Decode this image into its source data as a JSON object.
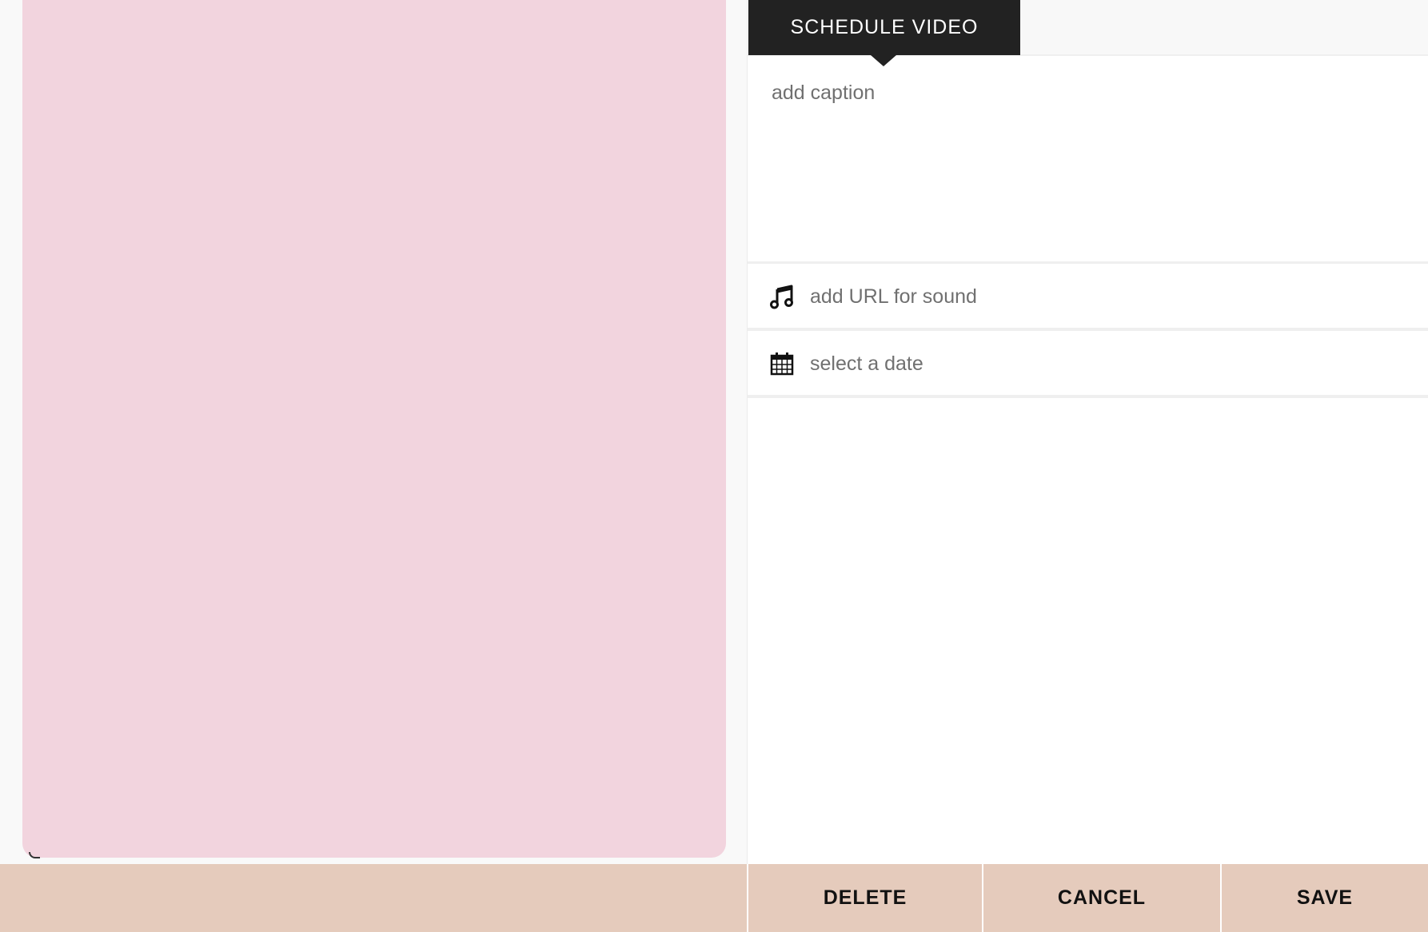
{
  "tabs": {
    "active_label": "SCHEDULE VIDEO"
  },
  "form": {
    "caption_placeholder": "add caption",
    "caption_value": "",
    "sound_placeholder": "add URL for sound",
    "sound_value": "",
    "date_placeholder": "select a date",
    "date_value": ""
  },
  "icons": {
    "sound": "music-note-icon",
    "date": "calendar-icon"
  },
  "actions": {
    "delete_label": "DELETE",
    "cancel_label": "CANCEL",
    "save_label": "SAVE"
  },
  "colors": {
    "preview_bg": "#f2d4de",
    "tab_active_bg": "#222222",
    "action_bar_bg": "#e5cbbc"
  }
}
